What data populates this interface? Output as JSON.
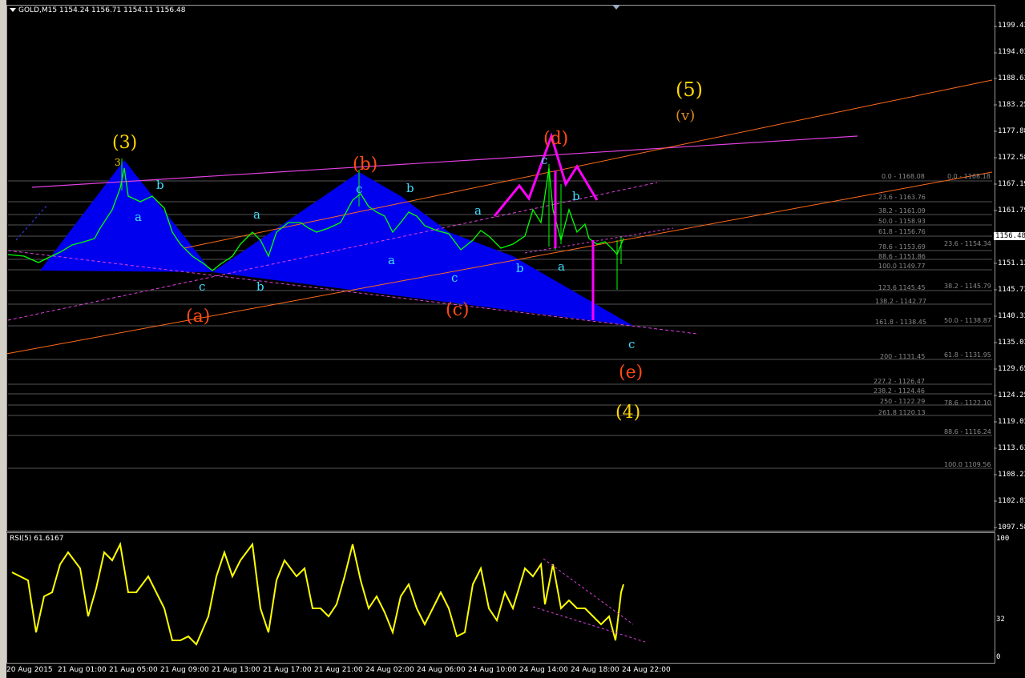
{
  "symbol": {
    "name": "GOLD,M15",
    "ohlc": "1154.24 1156.71 1154.11 1156.48"
  },
  "rsi": {
    "label": "RSI(5) 61.6167",
    "levels": [
      "100",
      "32",
      "0"
    ]
  },
  "price_axis": [
    "1199.43",
    "1194.03",
    "1188.63",
    "1183.25",
    "1177.88",
    "1172.58",
    "1167.19",
    "1161.79",
    "1156.48",
    "1151.13",
    "1145.73",
    "1140.33",
    "1135.03",
    "1129.65",
    "1124.25",
    "1119.03",
    "1113.63",
    "1108.23",
    "1102.83",
    "1097.58"
  ],
  "current_price": "1156.48",
  "time_axis": [
    "20 Aug 2015",
    "21 Aug 01:00",
    "21 Aug 05:00",
    "21 Aug 09:00",
    "21 Aug 13:00",
    "21 Aug 17:00",
    "21 Aug 21:00",
    "24 Aug 02:00",
    "24 Aug 06:00",
    "24 Aug 10:00",
    "24 Aug 14:00",
    "24 Aug 18:00",
    "24 Aug 22:00"
  ],
  "fib_set1": [
    "0.0 - 1168.08",
    "23.6 - 1163.76",
    "38.2 - 1161.09",
    "50.0 - 1158.93",
    "61.8 - 1156.76",
    "78.6 - 1153.69",
    "88.6 - 1151.86",
    "100.0 1149.77",
    "123.6 1145.45",
    "138.2 - 1142.77",
    "161.8 - 1138.45",
    "200 - 1131.45",
    "227.2 - 1126.47",
    "238.2 - 1124.46",
    "250 - 1122.29",
    "261.8 1120.13"
  ],
  "fib_set2": [
    "0.0 - 1168.18",
    "23.6 - 1154.34",
    "38.2 - 1145.79",
    "50.0 - 1138.87",
    "61.8 - 1131.95",
    "78.6 - 1122.10",
    "88.6 - 1116.24",
    "100.0 1109.56"
  ],
  "wave_labels": {
    "w3": "(3)",
    "w3small": "3",
    "w5": "(5)",
    "wv": "(v)",
    "w4": "(4)",
    "wa": "(a)",
    "wb": "(b)",
    "wc": "(c)",
    "wd": "(d)",
    "we": "(e)",
    "a": "a",
    "b": "b",
    "c": "c"
  },
  "colors": {
    "bull": "#00ff00",
    "bear": "#00ff00",
    "rsi": "#ffff00",
    "triangle": "#0000ff",
    "magenta": "#ff00ff",
    "orange": "#ff6a1a",
    "cyan": "#40e0ff",
    "yellow": "#ffd700"
  }
}
